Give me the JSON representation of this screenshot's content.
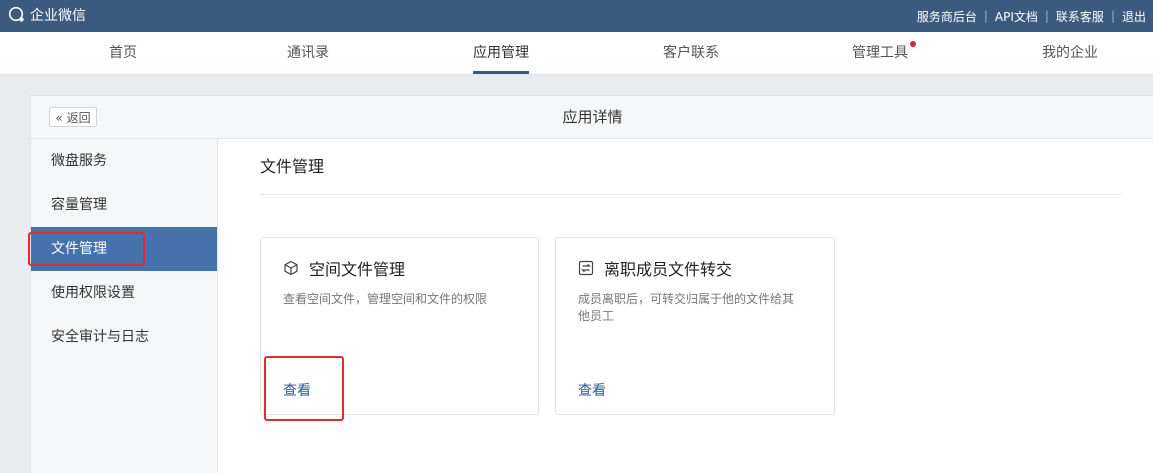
{
  "topbar": {
    "brand": "企业微信",
    "links": [
      "服务商后台",
      "API文档",
      "联系客服",
      "退出"
    ]
  },
  "nav": {
    "tabs": [
      {
        "label": "首页"
      },
      {
        "label": "通讯录"
      },
      {
        "label": "应用管理",
        "active": true
      },
      {
        "label": "客户联系"
      },
      {
        "label": "管理工具",
        "badge": "red-dot"
      },
      {
        "label": "我的企业"
      }
    ]
  },
  "panel": {
    "back_label": "« 返回",
    "title": "应用详情"
  },
  "sidebar": {
    "items": [
      {
        "label": "微盘服务"
      },
      {
        "label": "容量管理"
      },
      {
        "label": "文件管理",
        "active": true
      },
      {
        "label": "使用权限设置"
      },
      {
        "label": "安全审计与日志"
      }
    ]
  },
  "content": {
    "title": "文件管理",
    "cards": [
      {
        "icon": "cube-icon",
        "title": "空间文件管理",
        "description": [
          "查看空间文件，管理空间和文件的权限"
        ],
        "link": "查看"
      },
      {
        "icon": "transfer-icon",
        "title": "离职成员文件转交",
        "description": [
          "成员离职后，可转交归属于他的文件给其",
          "他员工"
        ],
        "link": "查看"
      }
    ]
  },
  "colors": {
    "topbar_bg": "#3c5a7e",
    "sidebar_active": "#4572ad",
    "highlight_box": "#e22a2a",
    "link": "#2b5a97"
  }
}
